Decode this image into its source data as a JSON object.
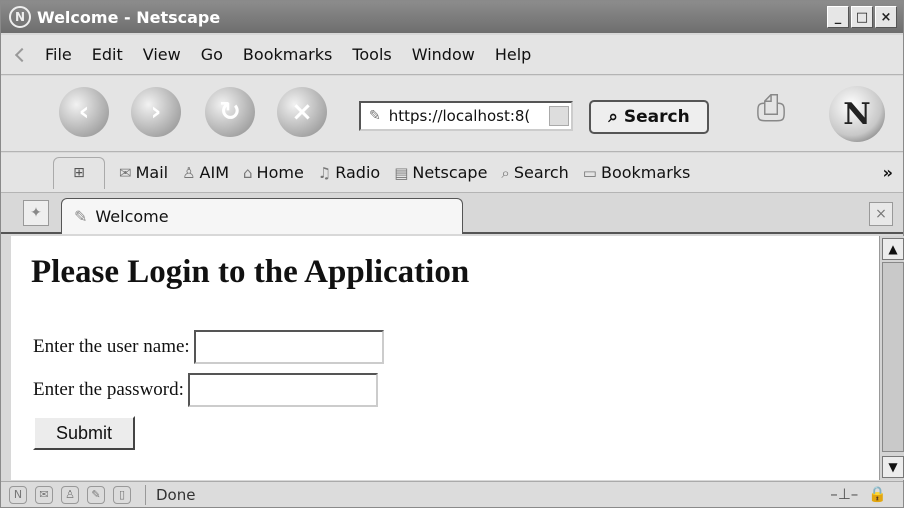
{
  "window": {
    "title": "Welcome - Netscape"
  },
  "menu": [
    "File",
    "Edit",
    "View",
    "Go",
    "Bookmarks",
    "Tools",
    "Window",
    "Help"
  ],
  "nav": {
    "url": "https://localhost:8(",
    "search_label": "Search"
  },
  "personal_toolbar": {
    "items": [
      "Mail",
      "AIM",
      "Home",
      "Radio",
      "Netscape",
      "Search",
      "Bookmarks"
    ],
    "more": "»"
  },
  "tab": {
    "title": "Welcome"
  },
  "page": {
    "heading": "Please Login to the Application",
    "username_label": "Enter the user name:",
    "password_label": "Enter the password:",
    "submit_label": "Submit"
  },
  "status": {
    "text": "Done"
  }
}
